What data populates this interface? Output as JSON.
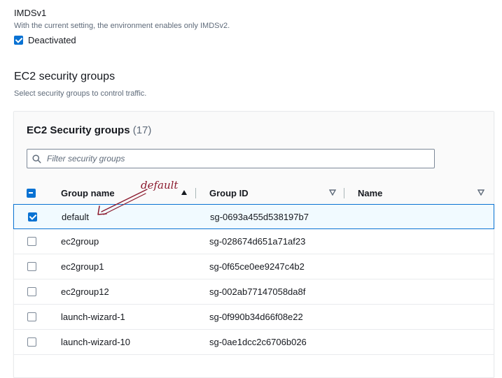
{
  "imds": {
    "title": "IMDSv1",
    "description": "With the current setting, the environment enables only IMDSv2.",
    "checkbox_label": "Deactivated",
    "checked": true
  },
  "security_groups_section": {
    "heading": "EC2 security groups",
    "description": "Select security groups to control traffic."
  },
  "table": {
    "title": "EC2 Security groups",
    "count": "(17)",
    "filter_placeholder": "Filter security groups",
    "columns": {
      "group_name": "Group name",
      "group_id": "Group ID",
      "name": "Name"
    },
    "rows": [
      {
        "group_name": "default",
        "group_id": "sg-0693a455d538197b7",
        "name": "",
        "selected": true
      },
      {
        "group_name": "ec2group",
        "group_id": "sg-028674d651a71af23",
        "name": "",
        "selected": false
      },
      {
        "group_name": "ec2group1",
        "group_id": "sg-0f65ce0ee9247c4b2",
        "name": "",
        "selected": false
      },
      {
        "group_name": "ec2group12",
        "group_id": "sg-002ab77147058da8f",
        "name": "",
        "selected": false
      },
      {
        "group_name": "launch-wizard-1",
        "group_id": "sg-0f990b34d66f08e22",
        "name": "",
        "selected": false
      },
      {
        "group_name": "launch-wizard-10",
        "group_id": "sg-0ae1dcc2c6706b026",
        "name": "",
        "selected": false
      }
    ]
  },
  "annotation": {
    "text": "default",
    "color": "#8b1a2e"
  },
  "colors": {
    "accent": "#0972d3",
    "selected_row_bg": "#f1faff",
    "muted_text": "#5f6b7a"
  },
  "icons": {
    "filter": "search-icon",
    "sort_ascending": "caret-up-icon",
    "sort_unsorted": "caret-down-icon",
    "arrow": "hand-drawn-arrow-icon"
  }
}
